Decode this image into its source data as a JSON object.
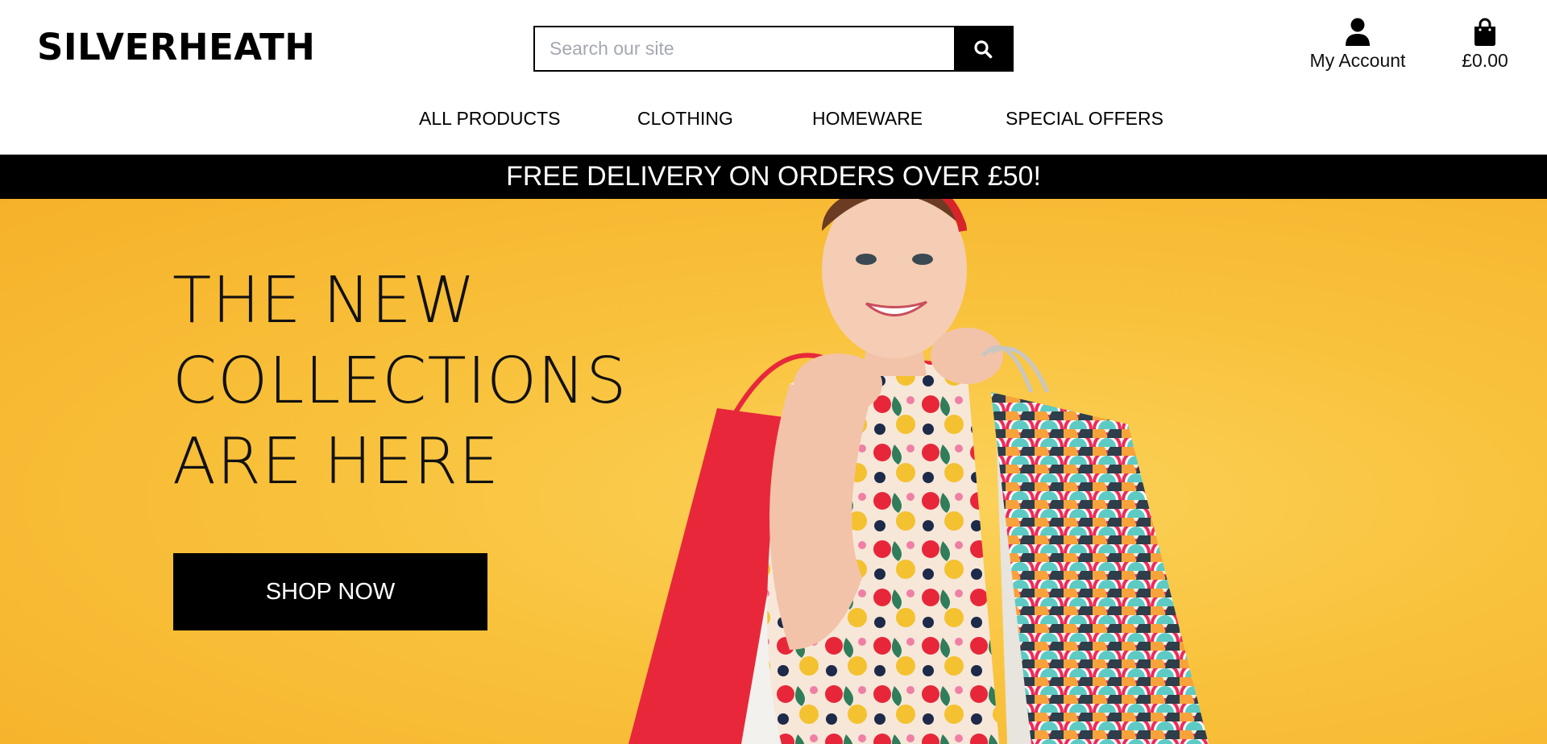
{
  "header": {
    "logo": "SILVERHEATH",
    "search": {
      "placeholder": "Search our site",
      "value": ""
    },
    "account": {
      "label": "My Account",
      "icon": "user-icon"
    },
    "cart": {
      "total": "£0.00",
      "icon": "shopping-bag-icon"
    }
  },
  "nav": {
    "items": [
      {
        "label": "ALL PRODUCTS"
      },
      {
        "label": "CLOTHING"
      },
      {
        "label": "HOMEWARE"
      },
      {
        "label": "SPECIAL OFFERS"
      }
    ]
  },
  "banner": {
    "text": "FREE DELIVERY ON ORDERS OVER £50!"
  },
  "hero": {
    "title": "THE NEW\nCOLLECTIONS\nARE HERE",
    "cta_label": "SHOP NOW",
    "background_color": "#f9c23c"
  }
}
